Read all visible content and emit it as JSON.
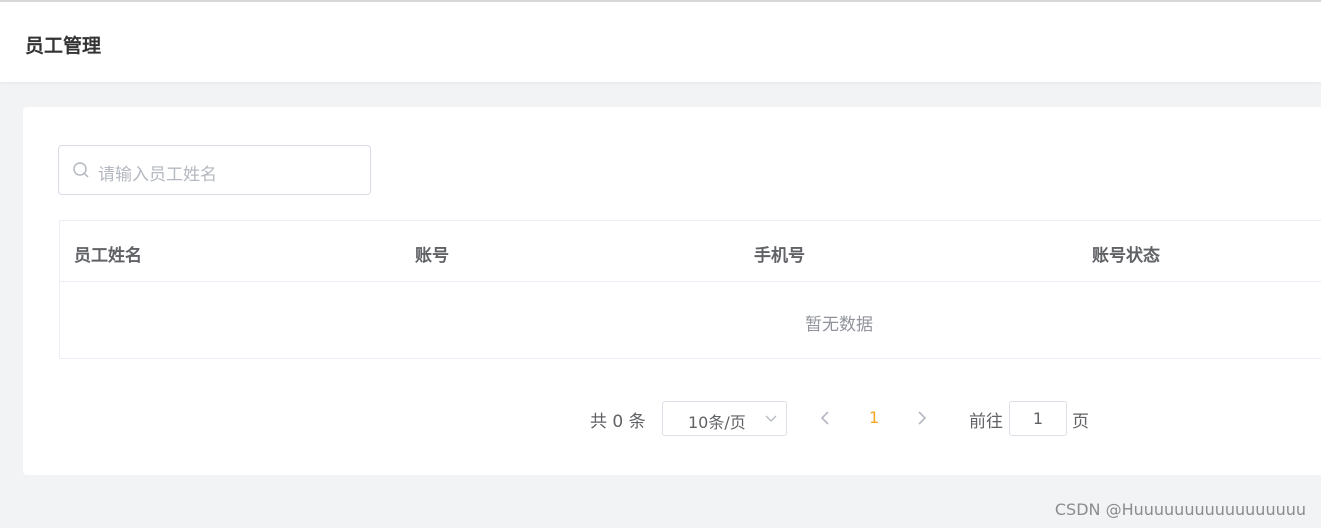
{
  "header": {
    "title": "员工管理"
  },
  "search": {
    "placeholder": "请输入员工姓名",
    "icon": "search-icon"
  },
  "table": {
    "columns": [
      "员工姓名",
      "账号",
      "手机号",
      "账号状态"
    ],
    "rows": [],
    "empty_text": "暂无数据"
  },
  "pagination": {
    "total_text": "共 0 条",
    "page_size": "10条/页",
    "current_page": "1",
    "goto_label": "前往",
    "goto_value": "1",
    "goto_suffix": "页",
    "accent_color": "#f5a623"
  },
  "watermark": "CSDN @Huuuuuuuuuuuuuuuuu"
}
